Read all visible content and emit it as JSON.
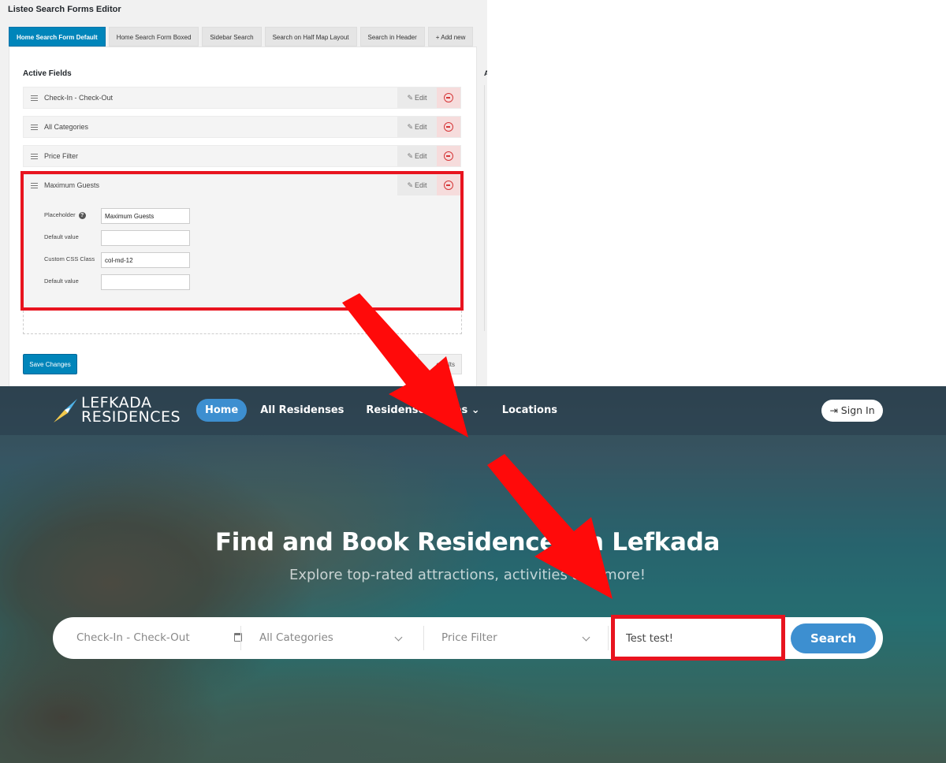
{
  "admin": {
    "title": "Listeo Search Forms Editor",
    "tabs": [
      {
        "label": "Home Search Form Default",
        "active": true
      },
      {
        "label": "Home Search Form Boxed",
        "active": false
      },
      {
        "label": "Sidebar Search",
        "active": false
      },
      {
        "label": "Search on Half Map Layout",
        "active": false
      },
      {
        "label": "Search in Header",
        "active": false
      },
      {
        "label": "+ Add new",
        "active": false
      }
    ],
    "side_label": "A",
    "active_fields_title": "Active Fields",
    "edit_label": "Edit",
    "fields": [
      {
        "label": "Check-In - Check-Out"
      },
      {
        "label": "All Categories"
      },
      {
        "label": "Price Filter"
      },
      {
        "label": "Maximum Guests"
      }
    ],
    "options": [
      {
        "label": "Placeholder",
        "value": "Maximum Guests"
      },
      {
        "label": "Default value",
        "value": ""
      },
      {
        "label": "Custom CSS Class",
        "value": "col-md-12"
      },
      {
        "label": "Default value",
        "value": ""
      }
    ],
    "help_glyph": "?",
    "save_label": "Save Changes",
    "defaults_label": "efaults"
  },
  "site": {
    "logo_line1": "LEFKADA",
    "logo_line2": "RESIDENCES",
    "nav": [
      {
        "label": "Home",
        "active": true
      },
      {
        "label": "All Residenses",
        "active": false
      },
      {
        "label": "Residenses Types ⌄",
        "active": false
      },
      {
        "label": "Locations",
        "active": false
      }
    ],
    "signin_label": "Sign In",
    "hero_title": "Find and Book Residences in Lefkada",
    "hero_subtitle": "Explore top-rated attractions, activities and more!",
    "search": {
      "dates_placeholder": "Check-In - Check-Out",
      "categories_value": "All Categories",
      "price_value": "Price Filter",
      "guests_value": "Test test!",
      "button_label": "Search"
    }
  },
  "colors": {
    "admin_primary": "#0085ba",
    "site_accent": "#3d8fd0",
    "highlight_red": "#e8141f"
  }
}
